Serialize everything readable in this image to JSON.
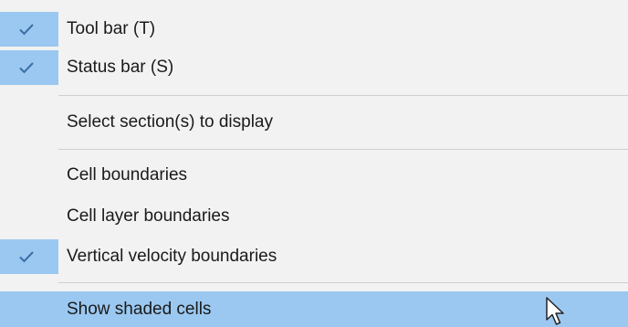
{
  "menu": {
    "items": [
      {
        "label": "Tool bar (T)",
        "checked": true
      },
      {
        "label": "Status bar (S)",
        "checked": true
      },
      {
        "label": "Select section(s) to display",
        "checked": false
      },
      {
        "label": "Cell boundaries",
        "checked": false
      },
      {
        "label": "Cell layer boundaries",
        "checked": false
      },
      {
        "label": "Vertical velocity boundaries",
        "checked": true
      },
      {
        "label": "Show shaded cells",
        "checked": false,
        "hovered": true
      }
    ]
  },
  "colors": {
    "background": "#f2f2f2",
    "check_bg": "#9bc8f0",
    "hover_bg": "#9bc8f0",
    "check_mark": "#3a6ea5",
    "separator": "#cfcfcf"
  },
  "icons": {
    "check": "checkmark-icon",
    "cursor": "mouse-pointer-icon"
  }
}
